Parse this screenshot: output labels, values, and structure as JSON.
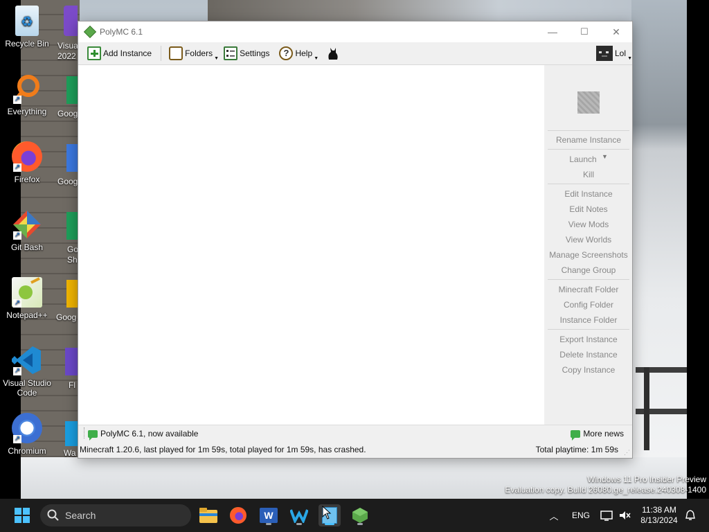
{
  "desktop": {
    "icons": [
      {
        "label": "Recycle Bin",
        "icon": "recycle-bin-icon"
      },
      {
        "label": "Everything",
        "icon": "everything-search-icon"
      },
      {
        "label": "Firefox",
        "icon": "firefox-icon"
      },
      {
        "label": "Git Bash",
        "icon": "git-bash-icon"
      },
      {
        "label": "Notepad++",
        "icon": "notepad-plus-plus-icon"
      },
      {
        "label": "Visual Studio Code",
        "icon": "vscode-icon"
      },
      {
        "label": "Chromium",
        "icon": "chromium-icon"
      }
    ],
    "partial_labels": [
      "Visua",
      "2022",
      "Goog",
      "Goog",
      "Go",
      "Sh",
      "Goog",
      "Fl",
      "Wa"
    ]
  },
  "window": {
    "title": "PolyMC 6.1",
    "controls": {
      "minimize": "—",
      "maximize": "☐",
      "close": "✕"
    },
    "toolbar": {
      "add_instance": "Add Instance",
      "folders": "Folders",
      "settings": "Settings",
      "help": "Help",
      "account": "Lol"
    },
    "side_panel": {
      "rename": "Rename Instance",
      "launch": "Launch",
      "kill": "Kill",
      "edit_instance": "Edit Instance",
      "edit_notes": "Edit Notes",
      "view_mods": "View Mods",
      "view_worlds": "View Worlds",
      "manage_screenshots": "Manage Screenshots",
      "change_group": "Change Group",
      "minecraft_folder": "Minecraft Folder",
      "config_folder": "Config Folder",
      "instance_folder": "Instance Folder",
      "export_instance": "Export Instance",
      "delete_instance": "Delete Instance",
      "copy_instance": "Copy Instance"
    },
    "news": {
      "latest": "PolyMC 6.1, now available",
      "more": "More news"
    },
    "status": {
      "left": "Minecraft 1.20.6, last played for 1m 59s, total played for 1m 59s, has crashed.",
      "right": "Total playtime: 1m 59s"
    }
  },
  "watermark": {
    "line1": "Windows 11 Pro Insider Preview",
    "line2": "Evaluation copy. Build 26080.ge_release.240308-1400"
  },
  "taskbar": {
    "search_placeholder": "Search",
    "language": "ENG",
    "time": "11:38 AM",
    "date": "8/13/2024"
  }
}
